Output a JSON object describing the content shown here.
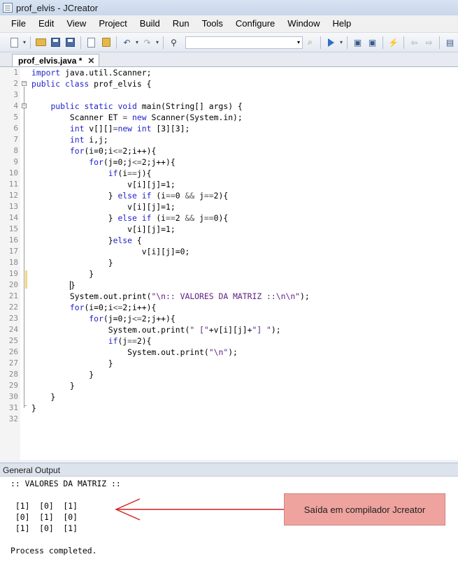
{
  "window": {
    "title": "prof_elvis - JCreator"
  },
  "menu": [
    "File",
    "Edit",
    "View",
    "Project",
    "Build",
    "Run",
    "Tools",
    "Configure",
    "Window",
    "Help"
  ],
  "tab": {
    "label": "prof_elvis.java *"
  },
  "code_lines": [
    [
      [
        "k",
        "import"
      ],
      [
        "t",
        " java.util.Scanner;"
      ]
    ],
    [
      [
        "k",
        "public class"
      ],
      [
        "t",
        " prof_elvis {"
      ]
    ],
    [],
    [
      [
        "t",
        "    "
      ],
      [
        "k",
        "public static void"
      ],
      [
        "t",
        " main(String[] args) {"
      ]
    ],
    [
      [
        "t",
        "        Scanner ET "
      ],
      [
        "o",
        "="
      ],
      [
        "t",
        " "
      ],
      [
        "k",
        "new"
      ],
      [
        "t",
        " Scanner(System.in);"
      ]
    ],
    [
      [
        "t",
        "        "
      ],
      [
        "k",
        "int"
      ],
      [
        "t",
        " v[][]"
      ],
      [
        "o",
        "="
      ],
      [
        "k",
        "new int"
      ],
      [
        "t",
        " [3][3];"
      ]
    ],
    [
      [
        "t",
        "        "
      ],
      [
        "k",
        "int"
      ],
      [
        "t",
        " i,j;"
      ]
    ],
    [
      [
        "t",
        "        "
      ],
      [
        "k",
        "for"
      ],
      [
        "t",
        "(i=0;i"
      ],
      [
        "o",
        "<="
      ],
      [
        "t",
        "2;i++){"
      ]
    ],
    [
      [
        "t",
        "            "
      ],
      [
        "k",
        "for"
      ],
      [
        "t",
        "(j=0;j"
      ],
      [
        "o",
        "<="
      ],
      [
        "t",
        "2;j++){"
      ]
    ],
    [
      [
        "t",
        "                "
      ],
      [
        "k",
        "if"
      ],
      [
        "t",
        "(i"
      ],
      [
        "o",
        "=="
      ],
      [
        "t",
        "j){"
      ]
    ],
    [
      [
        "t",
        "                    v[i][j]=1;"
      ]
    ],
    [
      [
        "t",
        "                } "
      ],
      [
        "k",
        "else if"
      ],
      [
        "t",
        " (i"
      ],
      [
        "o",
        "=="
      ],
      [
        "t",
        "0 "
      ],
      [
        "o",
        "&&"
      ],
      [
        "t",
        " j"
      ],
      [
        "o",
        "=="
      ],
      [
        "t",
        "2){"
      ]
    ],
    [
      [
        "t",
        "                    v[i][j]=1;"
      ]
    ],
    [
      [
        "t",
        "                } "
      ],
      [
        "k",
        "else if"
      ],
      [
        "t",
        " (i"
      ],
      [
        "o",
        "=="
      ],
      [
        "t",
        "2 "
      ],
      [
        "o",
        "&&"
      ],
      [
        "t",
        " j"
      ],
      [
        "o",
        "=="
      ],
      [
        "t",
        "0){"
      ]
    ],
    [
      [
        "t",
        "                    v[i][j]=1;"
      ]
    ],
    [
      [
        "t",
        "                }"
      ],
      [
        "k",
        "else"
      ],
      [
        "t",
        " {"
      ]
    ],
    [
      [
        "t",
        "                       v[i][j]=0;"
      ]
    ],
    [
      [
        "t",
        "                }"
      ]
    ],
    [
      [
        "t",
        "            }"
      ]
    ],
    [
      [
        "t",
        "        "
      ],
      [
        "c",
        ""
      ],
      [
        "t",
        "}"
      ]
    ],
    [
      [
        "t",
        "        System.out.print("
      ],
      [
        "s",
        "\"\\n:: VALORES DA MATRIZ ::\\n\\n\""
      ],
      [
        "t",
        ");"
      ]
    ],
    [
      [
        "t",
        "        "
      ],
      [
        "k",
        "for"
      ],
      [
        "t",
        "(i=0;i"
      ],
      [
        "o",
        "<="
      ],
      [
        "t",
        "2;i++){"
      ]
    ],
    [
      [
        "t",
        "            "
      ],
      [
        "k",
        "for"
      ],
      [
        "t",
        "(j=0;j"
      ],
      [
        "o",
        "<="
      ],
      [
        "t",
        "2;j++){"
      ]
    ],
    [
      [
        "t",
        "                System.out.print("
      ],
      [
        "s",
        "\" [\""
      ],
      [
        "t",
        "+v[i][j]+"
      ],
      [
        "s",
        "\"] \""
      ],
      [
        "t",
        ");"
      ]
    ],
    [
      [
        "t",
        "                "
      ],
      [
        "k",
        "if"
      ],
      [
        "t",
        "(j"
      ],
      [
        "o",
        "=="
      ],
      [
        "t",
        "2){"
      ]
    ],
    [
      [
        "t",
        "                    System.out.print("
      ],
      [
        "s",
        "\"\\n\""
      ],
      [
        "t",
        ");"
      ]
    ],
    [
      [
        "t",
        "                }"
      ]
    ],
    [
      [
        "t",
        "            }"
      ]
    ],
    [
      [
        "t",
        "        }"
      ]
    ],
    [
      [
        "t",
        "    }"
      ]
    ],
    [
      [
        "t",
        "}"
      ]
    ],
    []
  ],
  "output": {
    "header": "General Output",
    "lines": [
      ":: VALORES DA MATRIZ ::",
      "",
      " [1]  [0]  [1]",
      " [0]  [1]  [0]",
      " [1]  [0]  [1]",
      "",
      "Process completed."
    ]
  },
  "annotation": {
    "label": "Saída em compilador Jcreator"
  },
  "colors": {
    "keyword": "#2222cc",
    "string": "#5c1f82",
    "annotation_bg": "#eea39e",
    "arrow": "#d32020"
  }
}
